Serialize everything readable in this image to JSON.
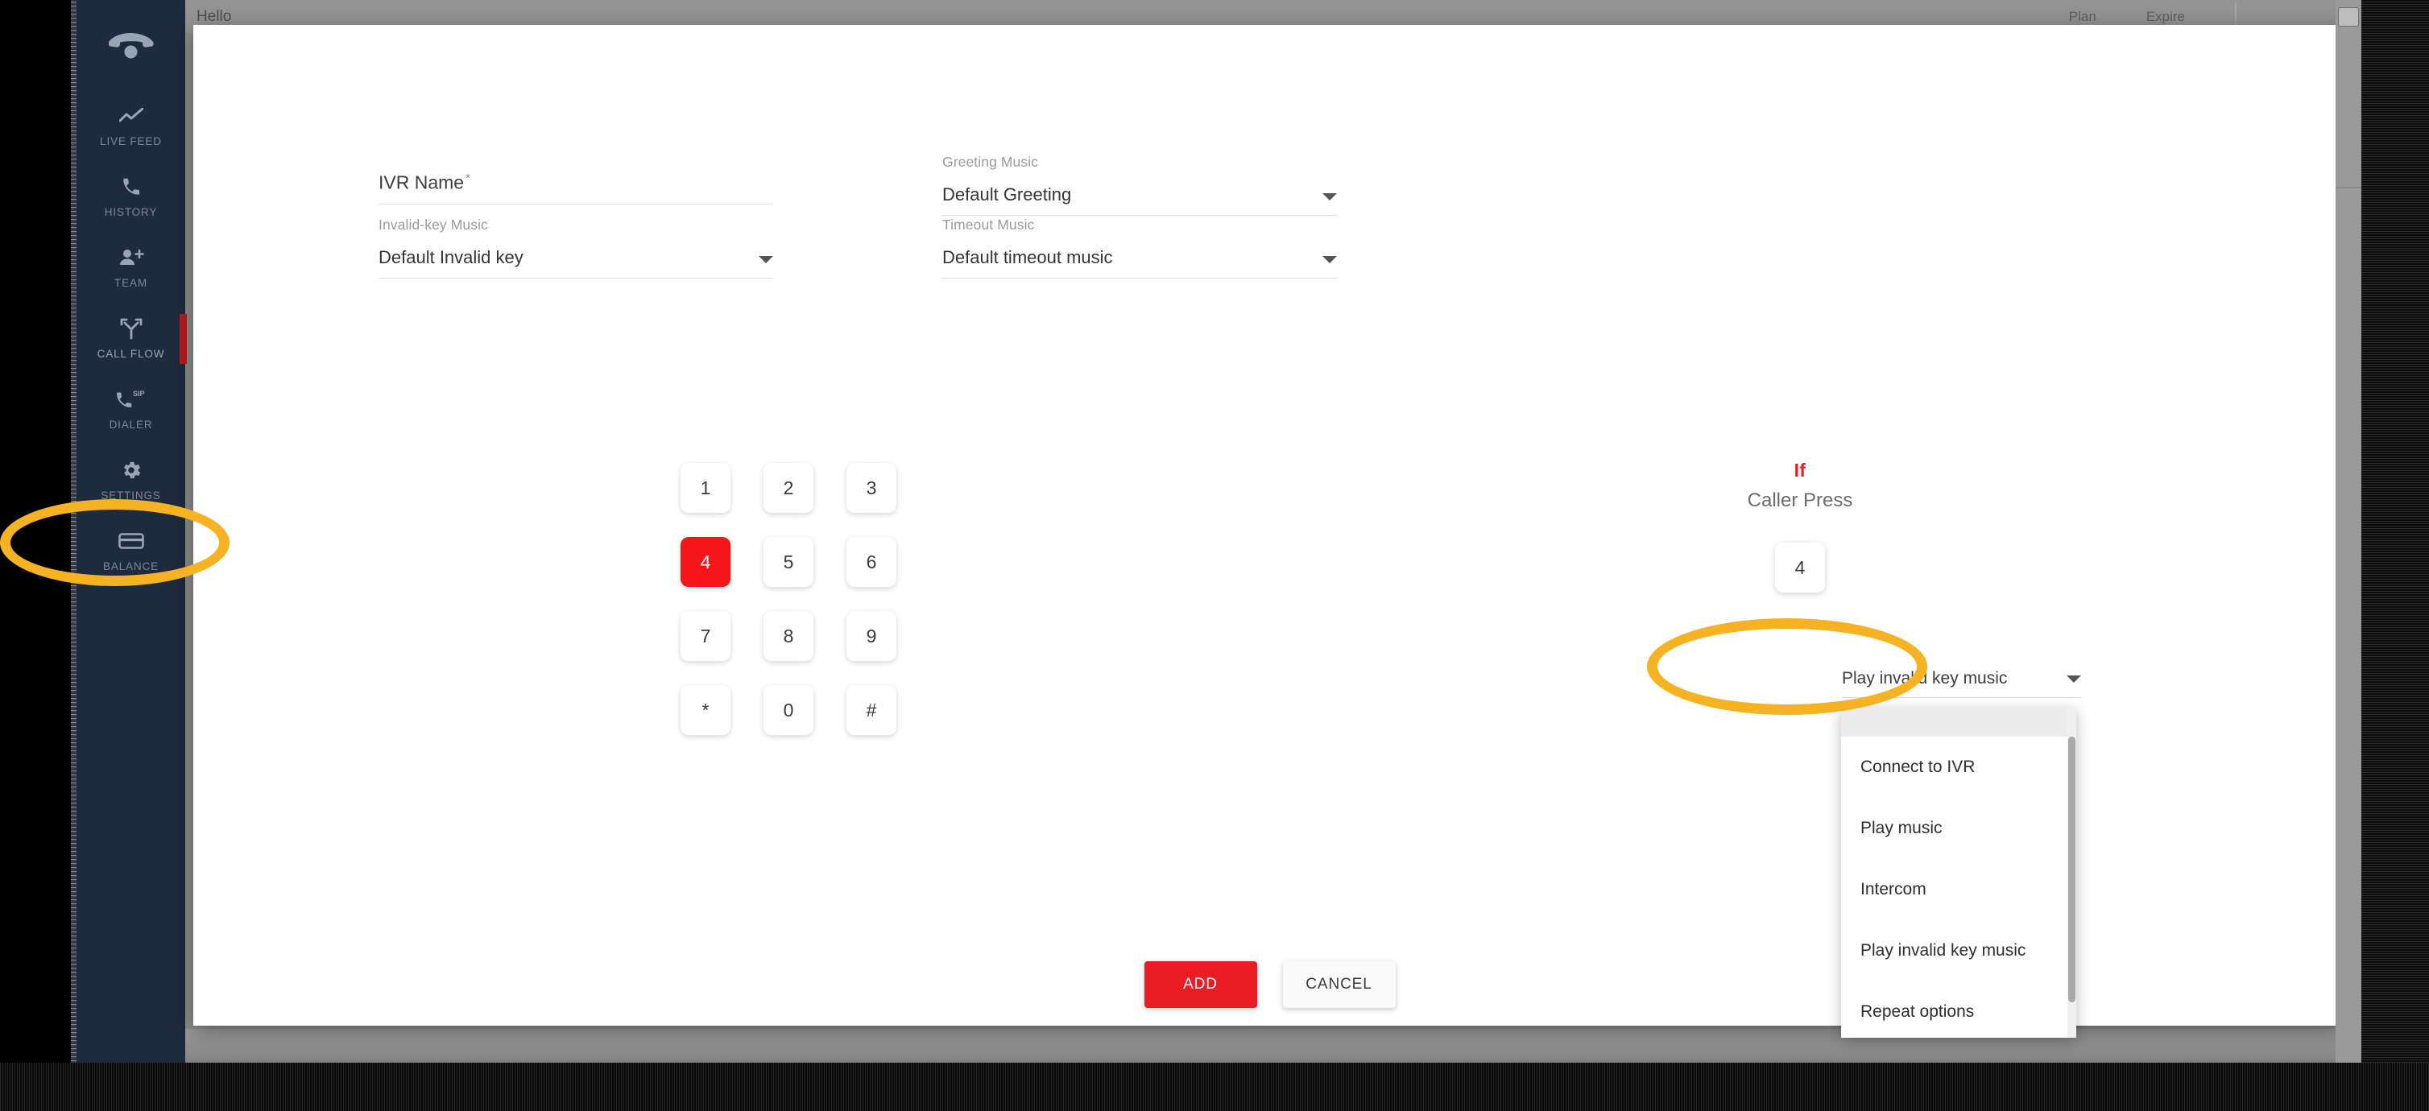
{
  "app_header": {
    "greeting": "Hello",
    "plan_label": "Plan",
    "expire_label": "Expire"
  },
  "sidebar": {
    "logo_icon": "phone-handset-icon",
    "items": [
      {
        "label": "LIVE FEED",
        "icon": "trend-line-icon",
        "active": false
      },
      {
        "label": "HISTORY",
        "icon": "phone-icon",
        "active": false
      },
      {
        "label": "TEAM",
        "icon": "add-person-icon",
        "active": false
      },
      {
        "label": "CALL FLOW",
        "icon": "call-flow-branch-icon",
        "active": true
      },
      {
        "label": "DIALER",
        "icon": "sip-phone-icon",
        "active": false
      },
      {
        "label": "SETTINGS",
        "icon": "gear-icon",
        "active": false
      },
      {
        "label": "BALANCE",
        "icon": "card-icon",
        "active": false
      }
    ]
  },
  "modal": {
    "fields": {
      "ivr_name": {
        "placeholder": "IVR Name",
        "required_mark": "*",
        "value": ""
      },
      "greeting_music": {
        "label": "Greeting Music",
        "value": "Default Greeting"
      },
      "invalid_key_music": {
        "label": "Invalid-key Music",
        "value": "Default Invalid key"
      },
      "timeout_music": {
        "label": "Timeout Music",
        "value": "Default timeout music"
      }
    },
    "keypad": {
      "keys": [
        "1",
        "2",
        "3",
        "4",
        "5",
        "6",
        "7",
        "8",
        "9",
        "*",
        "0",
        "#"
      ],
      "selected": "4"
    },
    "press_panel": {
      "if_word": "If",
      "title": "Caller Press",
      "selected_key": "4",
      "action_value": "Play invalid key music"
    },
    "dropdown": {
      "options": [
        "Connect to IVR",
        "Play music",
        "Intercom",
        "Play invalid key music",
        "Repeat options"
      ]
    },
    "actions": {
      "add_label": "ADD",
      "cancel_label": "CANCEL"
    }
  },
  "colors": {
    "accent_red": "#ea1c24",
    "selected_key_red": "#f5161c",
    "sidebar_bg": "#1e2a3d",
    "annotation": "#f5b222"
  }
}
